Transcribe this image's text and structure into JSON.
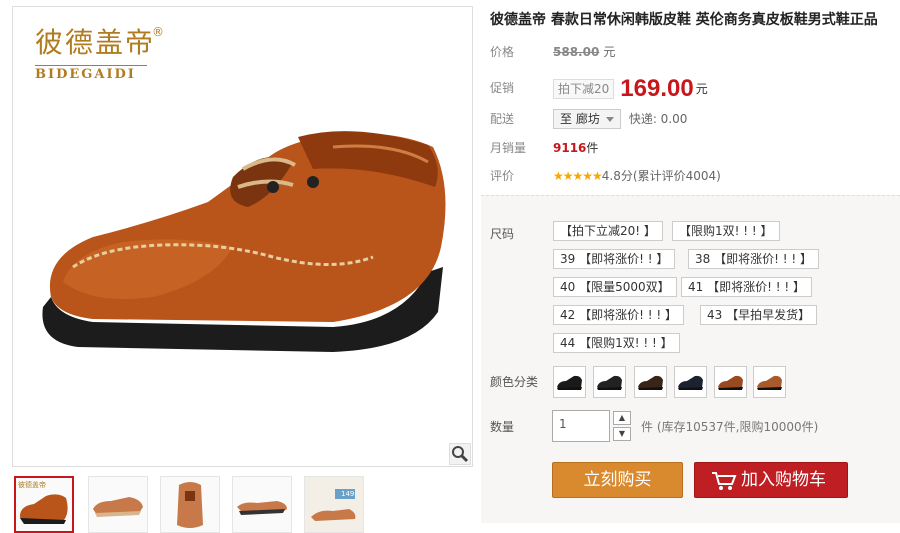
{
  "brand": {
    "name_cn": "彼德盖帝",
    "registered": "®",
    "name_en": "BIDEGAIDI"
  },
  "product": {
    "title": "彼德盖帝 春款日常休闲韩版皮鞋 英伦商务真皮板鞋男式鞋正品"
  },
  "price": {
    "label": "价格",
    "original": "588.00",
    "unit": "元"
  },
  "promo": {
    "label": "促销",
    "tag": "拍下减20",
    "price": "169.00",
    "unit": "元"
  },
  "shipping": {
    "label": "配送",
    "location": "至 廊坊",
    "fee": "快递: 0.00"
  },
  "sales": {
    "label": "月销量",
    "count": "9116",
    "unit": "件"
  },
  "rating": {
    "label": "评价",
    "stars": "★★★★★",
    "text": "4.8分(累计评价4004)"
  },
  "options": {
    "size_label": "尺码",
    "sizes": [
      "【拍下立减20! 】",
      "【限购1双! ! ! 】",
      "39 【即将涨价! ! 】",
      "38 【即将涨价! ! ! 】",
      "40 【限量5000双】",
      "41 【即将涨价! ! ! 】",
      "42 【即将涨价! ! ! 】",
      "43 【早拍早发货】",
      "44 【限购1双! ! ! 】"
    ],
    "color_label": "颜色分类",
    "colors": [
      "#1a1a1a",
      "#222222",
      "#3a2418",
      "#1c2230",
      "#9a4a20",
      "#a85a2a"
    ],
    "qty_label": "数量",
    "qty_value": "1",
    "stock_text": "件 (库存10537件,限购10000件)"
  },
  "actions": {
    "buy_now": "立刻购买",
    "add_cart": "加入购物车"
  },
  "thumb_tag": "彼德盖帝",
  "thumb_price": "149",
  "colors": {
    "accent_red": "#c8161d",
    "buy_orange": "#d9892e",
    "cart_red": "#bf1f23",
    "brand_gold": "#b07c20"
  }
}
